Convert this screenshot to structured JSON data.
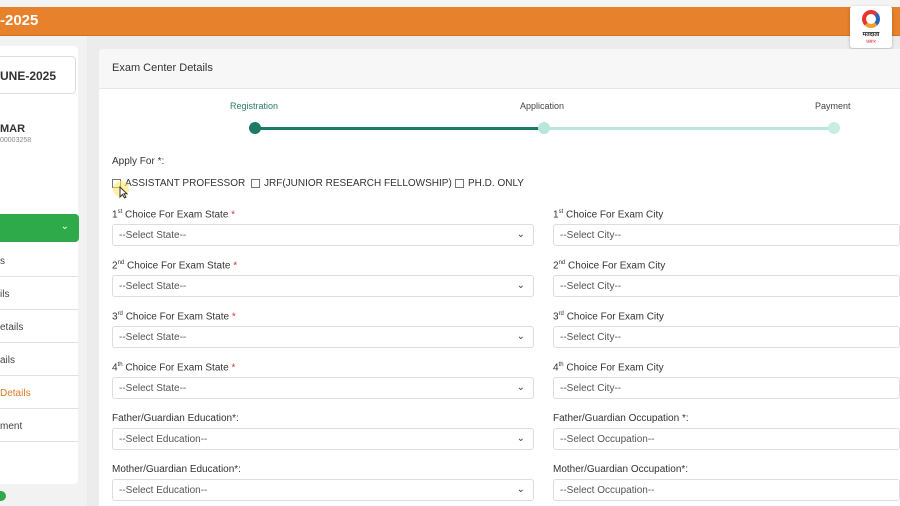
{
  "header": {
    "title": "-2025"
  },
  "logo": {
    "name": "broadcaster-logo",
    "text": "मतदाता",
    "sub": "प्रसार"
  },
  "sidebar": {
    "session": "UNE-2025",
    "user_name": "MAR",
    "user_id": "00003258",
    "items": [
      {
        "label": "s"
      },
      {
        "label": "ils"
      },
      {
        "label": "etails"
      },
      {
        "label": "ails"
      },
      {
        "label": "Details"
      },
      {
        "label": "ment"
      }
    ]
  },
  "main": {
    "title": "Exam Center Details"
  },
  "stepper": {
    "steps": [
      "Registration",
      "Application",
      "Payment"
    ],
    "colors": {
      "done": "#1f7a64",
      "pending": "#b8e6da"
    }
  },
  "apply": {
    "label": "Apply For *:",
    "options": [
      "ASSISTANT PROFESSOR",
      "JRF(JUNIOR RESEARCH FELLOWSHIP)",
      "PH.D. ONLY"
    ]
  },
  "fields": {
    "state1": {
      "sup": "st",
      "num": "1",
      "label": "Choice For Exam State",
      "req": "*",
      "value": "--Select State--"
    },
    "city1": {
      "sup": "st",
      "num": "1",
      "label": "Choice For Exam City",
      "value": "--Select City--"
    },
    "state2": {
      "sup": "nd",
      "num": "2",
      "label": "Choice For Exam State",
      "req": "*",
      "value": "--Select State--"
    },
    "city2": {
      "sup": "nd",
      "num": "2",
      "label": "Choice For Exam City",
      "value": "--Select City--"
    },
    "state3": {
      "sup": "rd",
      "num": "3",
      "label": "Choice For Exam State",
      "req": "*",
      "value": "--Select State--"
    },
    "city3": {
      "sup": "rd",
      "num": "3",
      "label": "Choice For Exam City",
      "value": "--Select City--"
    },
    "state4": {
      "sup": "th",
      "num": "4",
      "label": "Choice For Exam State",
      "req": "*",
      "value": "--Select State--"
    },
    "city4": {
      "sup": "th",
      "num": "4",
      "label": "Choice For Exam City",
      "value": "--Select City--"
    },
    "father_edu": {
      "label": "Father/Guardian Education*:",
      "value": "--Select Education--"
    },
    "father_occ": {
      "label": "Father/Guardian Occupation *:",
      "value": "--Select Occupation--"
    },
    "mother_edu": {
      "label": "Mother/Guardian Education*:",
      "value": "--Select Education--"
    },
    "mother_occ": {
      "label": "Mother/Guardian Occupation*:",
      "value": "--Select Occupation--"
    }
  }
}
